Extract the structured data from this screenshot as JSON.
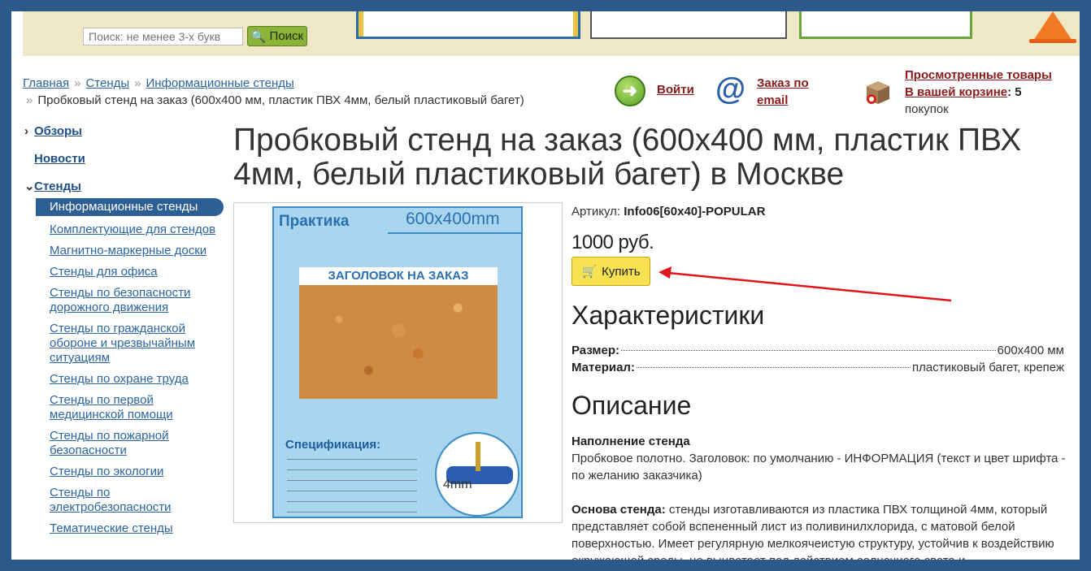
{
  "header": {
    "search_placeholder": "Поиск: не менее 3-х букв",
    "search_button": "Поиск"
  },
  "breadcrumb": {
    "items": [
      "Главная",
      "Стенды",
      "Информационные стенды"
    ],
    "separator": "»",
    "current": "Пробковый стенд на заказ (600х400 мм, пластик ПВХ 4мм, белый пластиковый багет)"
  },
  "utilities": {
    "login": "Войти",
    "order_email_line1": "Заказ по",
    "order_email_line2": "email",
    "viewed": "Просмотренные товары",
    "in_cart": "В вашей корзине",
    "cart_count": ": 5",
    "cart_suffix": "покупок"
  },
  "sidebar": {
    "top": [
      {
        "label": "Обзоры",
        "chevron": "›"
      },
      {
        "label": "Новости",
        "chevron": ""
      },
      {
        "label": "Стенды",
        "chevron": "⌄"
      }
    ],
    "items": [
      {
        "label": "Информационные стенды",
        "active": true
      },
      {
        "label": "Комплектующие для стендов"
      },
      {
        "label": "Магнитно-маркерные доски"
      },
      {
        "label": "Стенды для офиса"
      },
      {
        "label": "Стенды по безопасности дорожного движения"
      },
      {
        "label": "Стенды по гражданской обороне и чрезвычайным ситуациям"
      },
      {
        "label": "Стенды по охране труда"
      },
      {
        "label": "Стенды по первой медицинской помощи"
      },
      {
        "label": "Стенды по пожарной безопасности"
      },
      {
        "label": "Стенды по экологии"
      },
      {
        "label": "Стенды по электробезопасности"
      },
      {
        "label": "Тематические стенды"
      }
    ]
  },
  "product": {
    "title": "Пробковый стенд на заказ (600х400 мм, пластик ПВХ 4мм, белый пластиковый багет) в Москве",
    "article_label": "Артикул:",
    "article_value": "Info06[60x40]-POPULAR",
    "price": "1000 руб.",
    "buy_label": "Купить",
    "image": {
      "brand": "Практика",
      "size": "600x400mm",
      "header": "ЗАГОЛОВОК НА ЗАКАЗ",
      "spec_title": "Спецификация:",
      "thickness": "4mm"
    }
  },
  "characteristics": {
    "heading": "Характеристики",
    "rows": [
      {
        "key": "Размер:",
        "value": "600x400 мм"
      },
      {
        "key": "Материал:",
        "value": "пластиковый багет, крепеж"
      }
    ]
  },
  "description": {
    "heading": "Описание",
    "fill_title": "Наполнение стенда",
    "fill_text": "Пробковое полотно. Заголовок: по умолчанию - ИНФОРМАЦИЯ (текст и цвет шрифта - по желанию заказчика)",
    "base_title": "Основа стенда:",
    "base_text": "стенды изготавливаются из пластика ПВХ толщиной 4мм, который представляет собой вспененный лист из поливинилхлорида, с матовой белой поверхностью. Имеет регулярную мелкоячеистую структуру, устойчив к воздействию окружающей среды, не выцветает под действием солнечного света и"
  },
  "colors": {
    "background": "#2b5a8a",
    "link": "#2a64a2",
    "accent_red": "#8b1a1a",
    "buy_button": "#f9e252",
    "sidebar_active": "#2d5f95",
    "annotation_arrow": "#e0161b"
  }
}
